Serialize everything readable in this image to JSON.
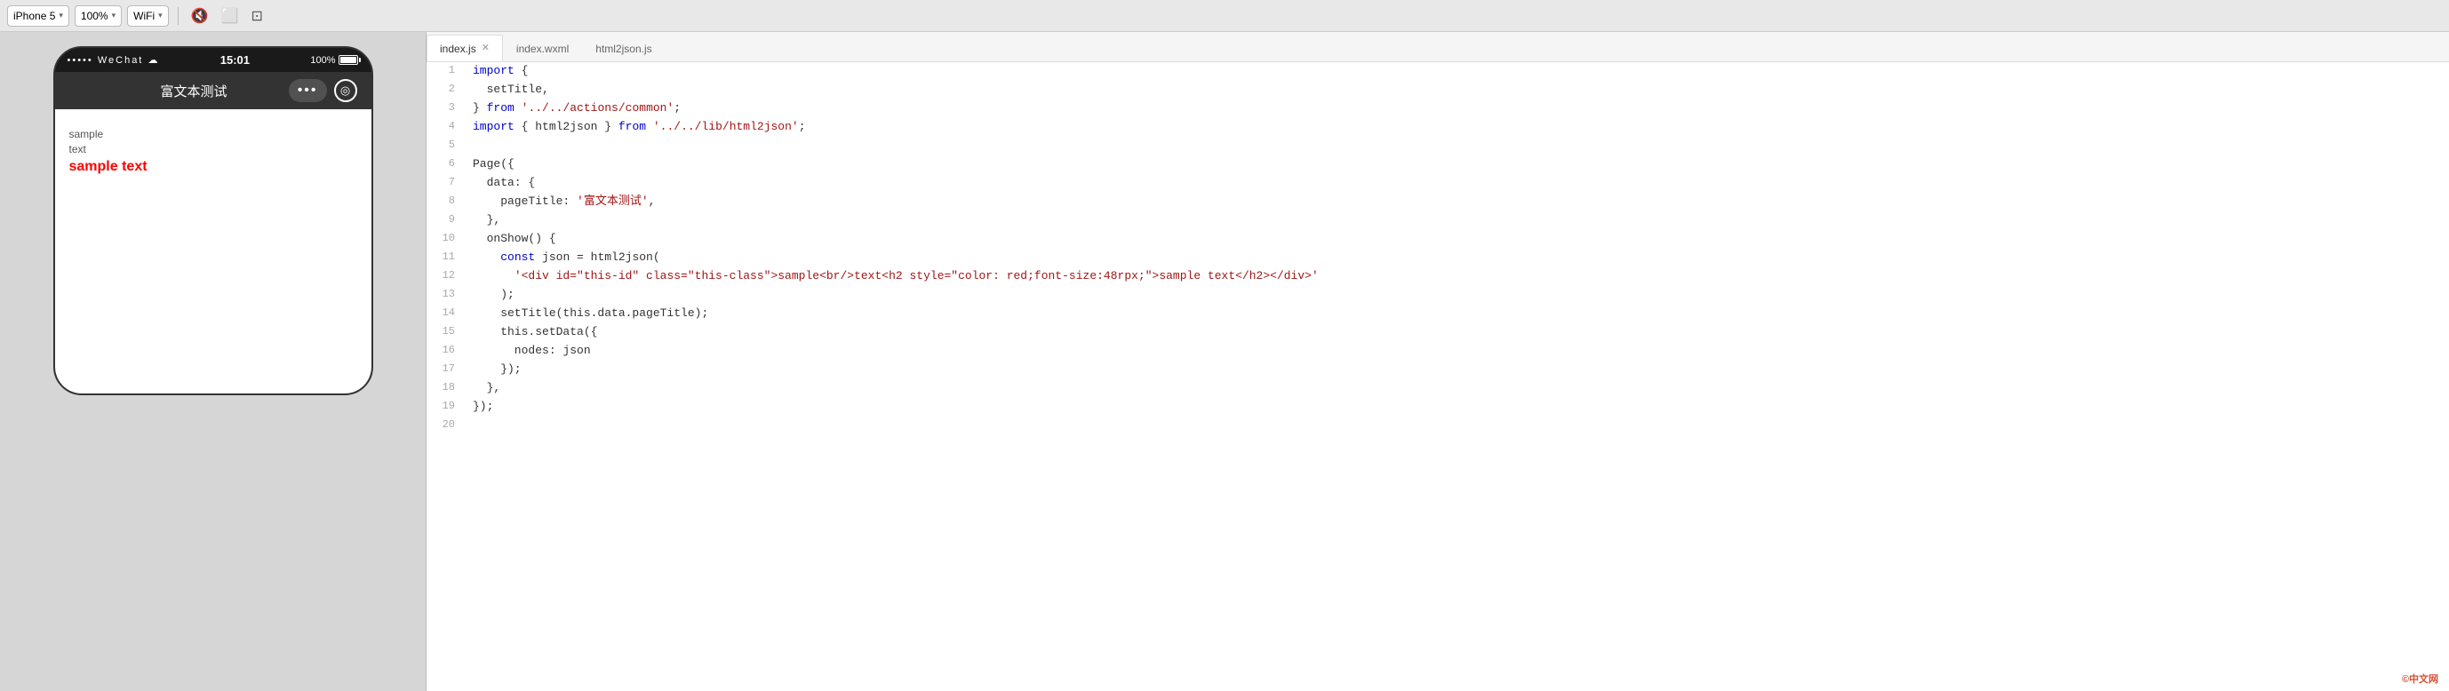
{
  "toolbar": {
    "device_label": "iPhone 5",
    "zoom_label": "100%",
    "network_label": "WiFi",
    "chevron": "▾"
  },
  "tabs": [
    {
      "id": "index-js",
      "label": "index.js",
      "active": true,
      "closable": true
    },
    {
      "id": "index-wxml",
      "label": "index.wxml",
      "active": false,
      "closable": false
    },
    {
      "id": "html2json-js",
      "label": "html2json.js",
      "active": false,
      "closable": false
    }
  ],
  "phone": {
    "status_signal": "•••••",
    "status_wechat": "WeChat",
    "status_wifi": "WiFi",
    "status_time": "15:01",
    "status_battery_pct": "100%",
    "nav_title": "富文本测试",
    "content_line1": "sample",
    "content_line2": "text",
    "content_bold": "sample text"
  },
  "code_lines": [
    {
      "num": 1,
      "tokens": [
        {
          "t": "kw",
          "v": "import"
        },
        {
          "t": "punc",
          "v": " {"
        }
      ]
    },
    {
      "num": 2,
      "tokens": [
        {
          "t": "plain",
          "v": "  setTitle,"
        }
      ]
    },
    {
      "num": 3,
      "tokens": [
        {
          "t": "punc",
          "v": "} "
        },
        {
          "t": "kw",
          "v": "from"
        },
        {
          "t": "punc",
          "v": " "
        },
        {
          "t": "str",
          "v": "'../../actions/common'"
        },
        {
          "t": "punc",
          "v": ";"
        }
      ]
    },
    {
      "num": 4,
      "tokens": [
        {
          "t": "kw",
          "v": "import"
        },
        {
          "t": "punc",
          "v": " { html2json } "
        },
        {
          "t": "kw",
          "v": "from"
        },
        {
          "t": "punc",
          "v": " "
        },
        {
          "t": "str",
          "v": "'../../lib/html2json'"
        },
        {
          "t": "punc",
          "v": ";"
        }
      ]
    },
    {
      "num": 5,
      "tokens": [
        {
          "t": "plain",
          "v": ""
        }
      ]
    },
    {
      "num": 6,
      "tokens": [
        {
          "t": "plain",
          "v": "Page({"
        }
      ]
    },
    {
      "num": 7,
      "tokens": [
        {
          "t": "plain",
          "v": "  data: {"
        }
      ]
    },
    {
      "num": 8,
      "tokens": [
        {
          "t": "plain",
          "v": "    pageTitle: "
        },
        {
          "t": "str",
          "v": "'富文本测试'"
        },
        {
          "t": "plain",
          "v": ","
        }
      ]
    },
    {
      "num": 9,
      "tokens": [
        {
          "t": "plain",
          "v": "  },"
        }
      ]
    },
    {
      "num": 10,
      "tokens": [
        {
          "t": "plain",
          "v": "  onShow() {"
        }
      ]
    },
    {
      "num": 11,
      "tokens": [
        {
          "t": "plain",
          "v": "    "
        },
        {
          "t": "kw",
          "v": "const"
        },
        {
          "t": "plain",
          "v": " json = html2json("
        }
      ]
    },
    {
      "num": 12,
      "tokens": [
        {
          "t": "plain",
          "v": "      "
        },
        {
          "t": "str",
          "v": "'<div id=\"this-id\" class=\"this-class\">sample<br/>text<h2 style=\"color: red;font-size:48rpx;\">sample text</h2></div>'"
        }
      ]
    },
    {
      "num": 13,
      "tokens": [
        {
          "t": "plain",
          "v": "    );"
        }
      ]
    },
    {
      "num": 14,
      "tokens": [
        {
          "t": "plain",
          "v": "    setTitle(this.data.pageTitle);"
        }
      ]
    },
    {
      "num": 15,
      "tokens": [
        {
          "t": "plain",
          "v": "    this.setData({"
        }
      ]
    },
    {
      "num": 16,
      "tokens": [
        {
          "t": "plain",
          "v": "      nodes: json"
        }
      ]
    },
    {
      "num": 17,
      "tokens": [
        {
          "t": "plain",
          "v": "    });"
        }
      ]
    },
    {
      "num": 18,
      "tokens": [
        {
          "t": "plain",
          "v": "  },"
        }
      ]
    },
    {
      "num": 19,
      "tokens": [
        {
          "t": "plain",
          "v": "});"
        }
      ]
    },
    {
      "num": 20,
      "tokens": [
        {
          "t": "plain",
          "v": ""
        }
      ]
    }
  ],
  "watermark": "©中文网"
}
